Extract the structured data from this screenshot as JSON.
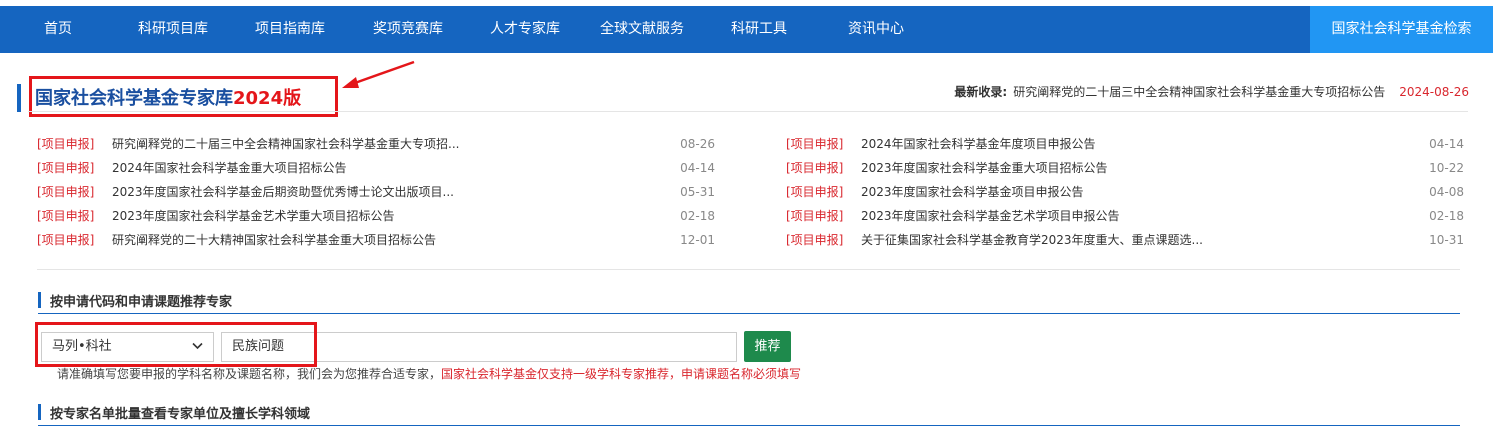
{
  "nav": {
    "items": [
      "首页",
      "科研项目库",
      "项目指南库",
      "奖项竞赛库",
      "人才专家库",
      "全球文献服务",
      "科研工具",
      "资讯中心"
    ],
    "right_button": "国家社会科学基金检索"
  },
  "header": {
    "title_main": "国家社会科学基金专家库",
    "title_year": "2024版",
    "latest_label": "最新收录:",
    "latest_text": "研究阐释党的二十届三中全会精神国家社会科学基金重大专项招标公告",
    "latest_date": "2024-08-26"
  },
  "news_left": [
    {
      "tag": "[项目申报]",
      "title": "研究阐释党的二十届三中全会精神国家社会科学基金重大专项招...",
      "date": "08-26"
    },
    {
      "tag": "[项目申报]",
      "title": "2024年国家社会科学基金重大项目招标公告",
      "date": "04-14"
    },
    {
      "tag": "[项目申报]",
      "title": "2023年度国家社会科学基金后期资助暨优秀博士论文出版项目...",
      "date": "05-31"
    },
    {
      "tag": "[项目申报]",
      "title": "2023年度国家社会科学基金艺术学重大项目招标公告",
      "date": "02-18"
    },
    {
      "tag": "[项目申报]",
      "title": "研究阐释党的二十大精神国家社会科学基金重大项目招标公告",
      "date": "12-01"
    }
  ],
  "news_right": [
    {
      "tag": "[项目申报]",
      "title": "2024年国家社会科学基金年度项目申报公告",
      "date": "04-14"
    },
    {
      "tag": "[项目申报]",
      "title": "2023年度国家社会科学基金重大项目招标公告",
      "date": "10-22"
    },
    {
      "tag": "[项目申报]",
      "title": "2023年度国家社会科学基金项目申报公告",
      "date": "04-08"
    },
    {
      "tag": "[项目申报]",
      "title": "2023年度国家社会科学基金艺术学项目申报公告",
      "date": "02-18"
    },
    {
      "tag": "[项目申报]",
      "title": "关于征集国家社会科学基金教育学2023年度重大、重点课题选...",
      "date": "10-31"
    }
  ],
  "section1": {
    "title": "按申请代码和申请课题推荐专家",
    "select_value": "马列•科社",
    "input_value": "民族问题",
    "button": "推荐",
    "hint_normal": "请准确填写您要申报的学科名称及课题名称，我们会为您推荐合适专家，",
    "hint_red": "国家社会科学基金仅支持一级学科专家推荐，申请课题名称必须填写"
  },
  "section2": {
    "title": "按专家名单批量查看专家单位及擅长学科领域"
  },
  "colors": {
    "nav": "#1565c0",
    "nav_right": "#2196f3",
    "highlight": "#e4161a",
    "button": "#1e8a4c"
  }
}
